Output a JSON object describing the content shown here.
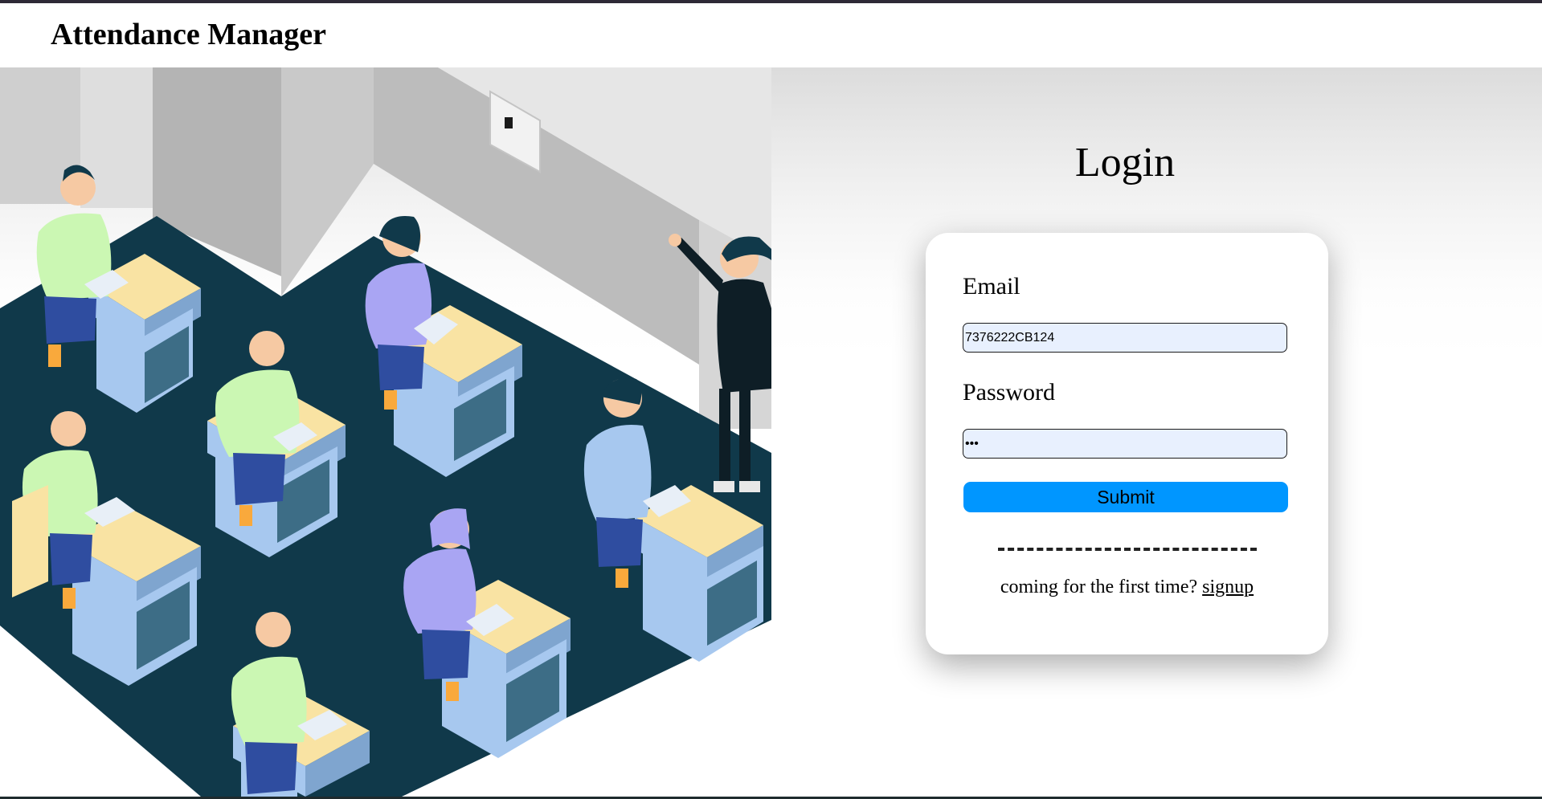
{
  "header": {
    "title": "Attendance Manager"
  },
  "illustration": {
    "semantic": "classroom-illustration",
    "description_icon": "classroom-illustration"
  },
  "login": {
    "heading": "Login",
    "email_label": "Email",
    "email_value": "7376222CB124",
    "password_label": "Password",
    "password_value": "•••",
    "submit_label": "Submit",
    "divider_text": "",
    "signup_prompt": "coming for the first time?",
    "signup_link": "signup"
  },
  "colors": {
    "accent_button": "#0096ff",
    "input_background": "#e8f0fe",
    "floor": "#10394a",
    "desk_top": "#f9e3a3",
    "desk_leg": "#a7c8ef",
    "shirt_green": "#cbf7b3",
    "shirt_purple": "#a9a5f3"
  }
}
